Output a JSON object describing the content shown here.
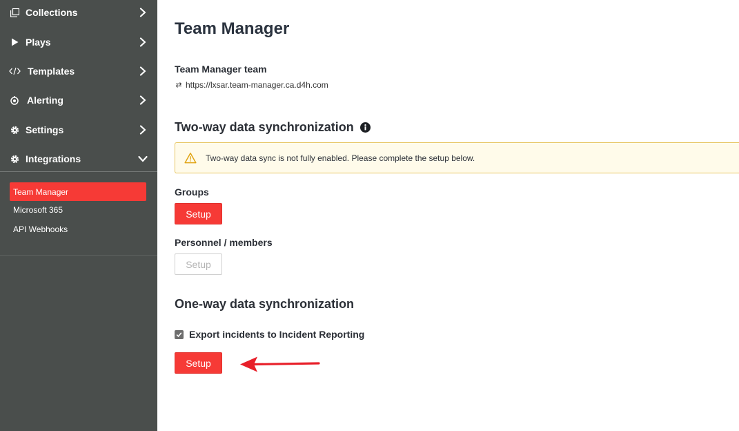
{
  "sidebar": {
    "items": [
      {
        "label": "Collections",
        "icon": "collections-icon"
      },
      {
        "label": "Plays",
        "icon": "play-icon"
      },
      {
        "label": "Templates",
        "icon": "code-icon"
      },
      {
        "label": "Alerting",
        "icon": "alerting-icon"
      },
      {
        "label": "Settings",
        "icon": "gear-icon"
      },
      {
        "label": "Integrations",
        "icon": "gear-icon",
        "expanded": true
      }
    ],
    "sub_items": [
      {
        "label": "Team Manager",
        "active": true
      },
      {
        "label": "Microsoft 365"
      },
      {
        "label": "API Webhooks"
      }
    ]
  },
  "main": {
    "title": "Team Manager",
    "team_name": "Team Manager team",
    "team_url": "https://lxsar.team-manager.ca.d4h.com",
    "two_way": {
      "title": "Two-way data synchronization",
      "alert": "Two-way data sync is not fully enabled. Please complete the setup below.",
      "groups_label": "Groups",
      "groups_button": "Setup",
      "personnel_label": "Personnel / members",
      "personnel_button": "Setup"
    },
    "one_way": {
      "title": "One-way data synchronization",
      "export_label": "Export incidents to Incident Reporting",
      "export_checked": true,
      "export_button": "Setup"
    }
  },
  "colors": {
    "sidebar_bg": "#4a4e4c",
    "accent": "#f63a36",
    "alert_bg": "#fffbea",
    "alert_border": "#e7c560",
    "annotation_arrow": "#e8202a"
  }
}
